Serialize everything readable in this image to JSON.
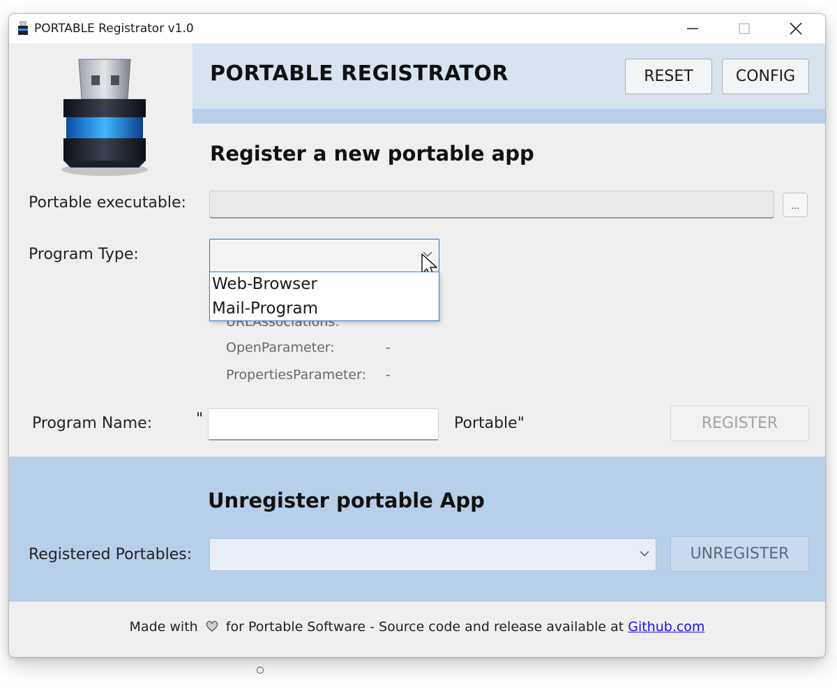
{
  "window": {
    "title": "PORTABLE Registrator v1.0",
    "controls": {
      "minimize": "minimize-icon",
      "maximize": "maximize-icon",
      "close": "close-icon"
    }
  },
  "header": {
    "title": "PORTABLE REGISTRATOR",
    "reset_label": "RESET",
    "config_label": "CONFIG",
    "logo": "usb-drive-icon"
  },
  "register": {
    "section_title": "Register a new portable app",
    "exe_label": "Portable executable:",
    "exe_value": "",
    "browse_label": "...",
    "type_label": "Program Type:",
    "type_value": "",
    "type_options": [
      "Web-Browser",
      "Mail-Program"
    ],
    "params": {
      "url_label": "URLAssociations:",
      "open_label": "OpenParameter:",
      "open_value": "-",
      "props_label": "PropertiesParameter:",
      "props_value": "-"
    },
    "name_label": "Program Name:",
    "name_prefix": "\"",
    "name_value": "",
    "name_suffix": "Portable\"",
    "register_label": "REGISTER"
  },
  "unregister": {
    "section_title": "Unregister portable App",
    "portables_label": "Registered Portables:",
    "portables_value": "",
    "unregister_label": "UNREGISTER"
  },
  "footer": {
    "text_before": "Made with",
    "text_after": "for Portable Software - Source code and release available at",
    "link_text": "Github.com"
  },
  "colors": {
    "header_band": "#d8e3f0",
    "accent_band": "#b8cfea",
    "focus_border": "#1f6fcb",
    "link": "#1a0dff"
  }
}
